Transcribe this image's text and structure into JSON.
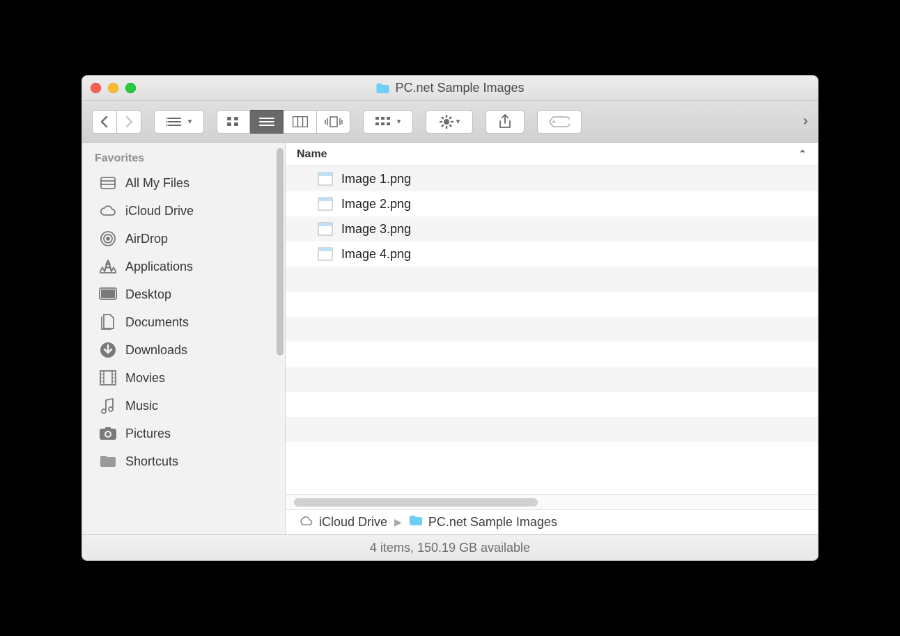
{
  "window": {
    "title": "PC.net Sample Images"
  },
  "sidebar": {
    "section": "Favorites",
    "items": [
      {
        "label": "All My Files",
        "icon": "all-my-files"
      },
      {
        "label": "iCloud Drive",
        "icon": "cloud"
      },
      {
        "label": "AirDrop",
        "icon": "airdrop"
      },
      {
        "label": "Applications",
        "icon": "applications"
      },
      {
        "label": "Desktop",
        "icon": "desktop"
      },
      {
        "label": "Documents",
        "icon": "documents"
      },
      {
        "label": "Downloads",
        "icon": "downloads"
      },
      {
        "label": "Movies",
        "icon": "movies"
      },
      {
        "label": "Music",
        "icon": "music"
      },
      {
        "label": "Pictures",
        "icon": "pictures"
      },
      {
        "label": "Shortcuts",
        "icon": "folder"
      }
    ]
  },
  "columns": {
    "name": "Name"
  },
  "files": [
    {
      "name": "Image 1.png"
    },
    {
      "name": "Image 2.png"
    },
    {
      "name": "Image 3.png"
    },
    {
      "name": "Image 4.png"
    }
  ],
  "path": {
    "crumb0": "iCloud Drive",
    "crumb1": "PC.net Sample Images"
  },
  "status": "4 items, 150.19 GB available"
}
